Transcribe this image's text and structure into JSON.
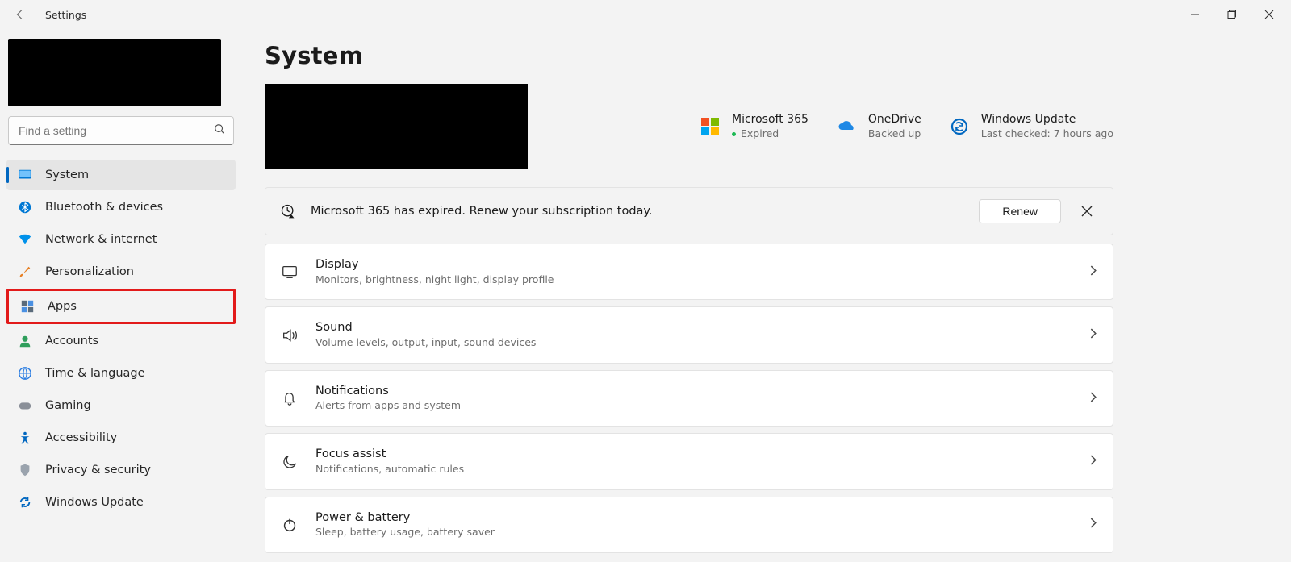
{
  "window": {
    "title": "Settings"
  },
  "search": {
    "placeholder": "Find a setting"
  },
  "nav": [
    {
      "label": "System"
    },
    {
      "label": "Bluetooth & devices"
    },
    {
      "label": "Network & internet"
    },
    {
      "label": "Personalization"
    },
    {
      "label": "Apps"
    },
    {
      "label": "Accounts"
    },
    {
      "label": "Time & language"
    },
    {
      "label": "Gaming"
    },
    {
      "label": "Accessibility"
    },
    {
      "label": "Privacy & security"
    },
    {
      "label": "Windows Update"
    }
  ],
  "page": {
    "heading": "System"
  },
  "tiles": {
    "m365": {
      "title": "Microsoft 365",
      "sub": "Expired"
    },
    "onedrive": {
      "title": "OneDrive",
      "sub": "Backed up"
    },
    "update": {
      "title": "Windows Update",
      "sub": "Last checked: 7 hours ago"
    }
  },
  "banner": {
    "text": "Microsoft 365 has expired. Renew your subscription today.",
    "button": "Renew"
  },
  "cards": [
    {
      "title": "Display",
      "sub": "Monitors, brightness, night light, display profile"
    },
    {
      "title": "Sound",
      "sub": "Volume levels, output, input, sound devices"
    },
    {
      "title": "Notifications",
      "sub": "Alerts from apps and system"
    },
    {
      "title": "Focus assist",
      "sub": "Notifications, automatic rules"
    },
    {
      "title": "Power & battery",
      "sub": "Sleep, battery usage, battery saver"
    }
  ]
}
